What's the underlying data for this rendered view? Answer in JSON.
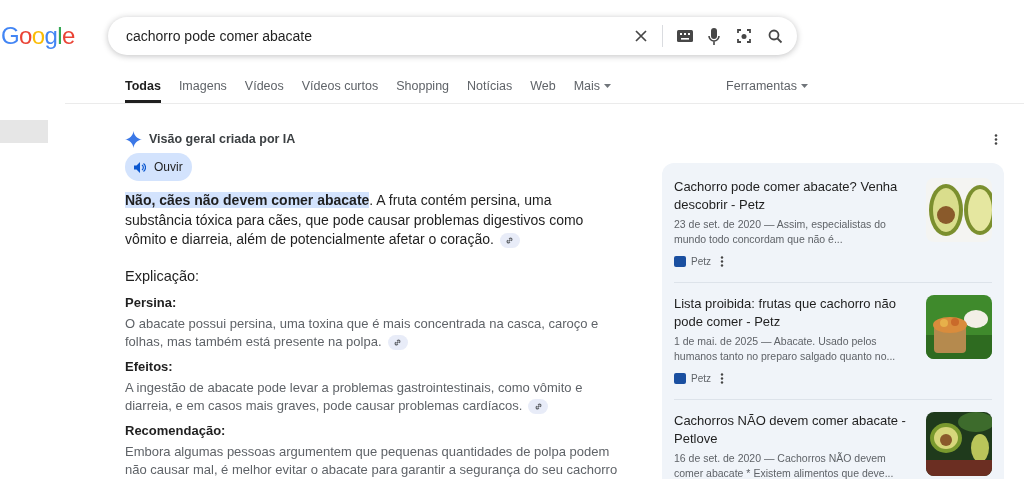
{
  "logo": "Google",
  "search": {
    "value": "cachorro pode comer abacate"
  },
  "tabs": [
    {
      "label": "Todas",
      "selected": true,
      "dropdown": false
    },
    {
      "label": "Imagens",
      "selected": false,
      "dropdown": false
    },
    {
      "label": "Vídeos",
      "selected": false,
      "dropdown": false
    },
    {
      "label": "Vídeos curtos",
      "selected": false,
      "dropdown": false
    },
    {
      "label": "Shopping",
      "selected": false,
      "dropdown": false
    },
    {
      "label": "Notícias",
      "selected": false,
      "dropdown": false
    },
    {
      "label": "Web",
      "selected": false,
      "dropdown": false
    },
    {
      "label": "Mais",
      "selected": false,
      "dropdown": true
    }
  ],
  "tools": {
    "label": "Ferramentas"
  },
  "ai_overview": {
    "title": "Visão geral criada por IA",
    "listen_button": "Ouvir",
    "highlight": "Não, cães não devem comer abacate",
    "answer": ". A fruta contém persina, uma substância tóxica para cães, que pode causar problemas digestivos como vômito e diarreia, além de potencialmente afetar o coração.",
    "heading": "Explicação:",
    "sections": [
      {
        "title": "Persina:",
        "text": "O abacate possui persina, uma toxina que é mais concentrada na casca, caroço e folhas, mas também está presente na polpa.",
        "link": true
      },
      {
        "title": "Efeitos:",
        "text": "A ingestão de abacate pode levar a problemas gastrointestinais, como vômito e diarreia, e em casos mais graves, pode causar problemas cardíacos.",
        "link": true
      },
      {
        "title": "Recomendação:",
        "text": "Embora algumas pessoas argumentem que pequenas quantidades de polpa podem não causar mal, é melhor evitar o abacate para garantir a segurança do seu cachorro",
        "link": false
      }
    ]
  },
  "sources": [
    {
      "title": "Cachorro pode comer abacate? Venha descobrir - Petz",
      "snippet": "23 de set. de 2020 — Assim, especialistas do mundo todo concordam que não é...",
      "site": "Petz",
      "kind": "picture"
    },
    {
      "title": "Lista proibida: frutas que cachorro não pode comer - Petz",
      "snippet": "1 de mai. de 2025 — Abacate. Usado pelos humanos tanto no preparo salgado quanto no...",
      "site": "Petz",
      "kind": "picture"
    },
    {
      "title": "Cachorros NÃO devem comer abacate - Petlove",
      "snippet": "16 de set. de 2020 — Cachorros NÃO devem comer abacate * Existem alimentos que deve...",
      "kind": "picture"
    }
  ]
}
